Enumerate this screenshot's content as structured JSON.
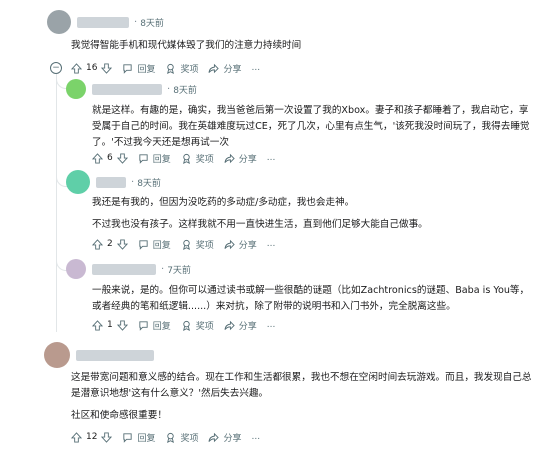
{
  "comments": [
    {
      "time": "8天前",
      "lines": [
        "我觉得智能手机和现代媒体毁了我们的注意力持续时间"
      ],
      "votes": "16",
      "reply": "回复",
      "award": "奖项",
      "share": "分享",
      "more": "...",
      "collapse": "−",
      "avatar_color": "#9aa3a8"
    },
    {
      "time": "8天前",
      "lines": [
        "就是这样。有趣的是，确实，我当爸爸后第一次设置了我的Xbox。妻子和孩子都睡着了，我启动它，享受属于自己的时间。我在英雄难度玩过CE，死了几次，心里有点生气，'该死我没时间玩了，我得去睡觉了。'不过我今天还是想再试一次"
      ],
      "votes": "6",
      "reply": "回复",
      "award": "奖项",
      "share": "分享",
      "more": "...",
      "avatar_color": "#7bd36a"
    },
    {
      "time": "8天前",
      "lines": [
        "我还是有我的，但因为没吃药的多动症/多动症，我也会走神。",
        "不过我也没有孩子。这样我就不用一直快进生活，直到他们足够大能自己做事。"
      ],
      "votes": "2",
      "reply": "回复",
      "award": "奖项",
      "share": "分享",
      "more": "...",
      "avatar_color": "#5fcfa8"
    },
    {
      "time": "7天前",
      "lines": [
        "一般来说，是的。但你可以通过读书或解一些很酷的谜题（比如Zachtronics的谜题、Baba is You等，或者经典的笔和纸逻辑......）来对抗，除了附带的说明书和入门书外，完全脱离这些。"
      ],
      "votes": "1",
      "reply": "回复",
      "award": "奖项",
      "share": "分享",
      "more": "...",
      "avatar_color": "#c9b9d2"
    },
    {
      "time": "",
      "lines": [
        "这是带宽问题和意义感的结合。现在工作和生活都很累，我也不想在空闲时间去玩游戏。而且，我发现自己总是潜意识地想'这有什么意义？'然后失去兴趣。",
        "社区和使命感很重要！"
      ],
      "votes": "12",
      "reply": "回复",
      "award": "奖项",
      "share": "分享",
      "more": "...",
      "avatar_color": "#b99a8e"
    }
  ],
  "colors": {
    "meta": "#576f76",
    "text": "#1a1a1b",
    "thread_line": "#e2e6e8"
  }
}
